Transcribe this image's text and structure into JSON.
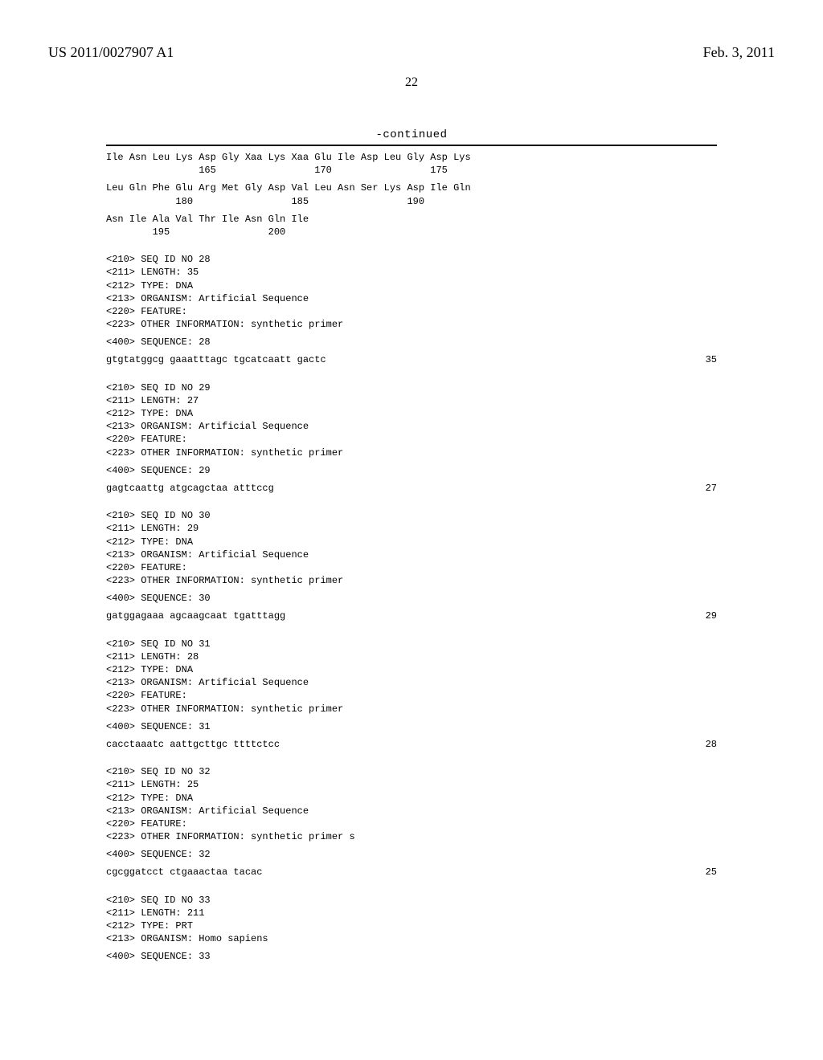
{
  "header": {
    "publication_id": "US 2011/0027907 A1",
    "publication_date": "Feb. 3, 2011",
    "page_number": "22"
  },
  "continued_label": "-continued",
  "protein_tail": {
    "row1_aa": "Ile Asn Leu Lys Asp Gly Xaa Lys Xaa Glu Ile Asp Leu Gly Asp Lys",
    "row1_pos": "                165                 170                 175",
    "row2_aa": "Leu Gln Phe Glu Arg Met Gly Asp Val Leu Asn Ser Lys Asp Ile Gln",
    "row2_pos": "            180                 185                 190",
    "row3_aa": "Asn Ile Ala Val Thr Ile Asn Gln Ile",
    "row3_pos": "        195                 200"
  },
  "entries": [
    {
      "seq_id": "<210> SEQ ID NO 28",
      "length": "<211> LENGTH: 35",
      "type": "<212> TYPE: DNA",
      "organism": "<213> ORGANISM: Artificial Sequence",
      "feature": "<220> FEATURE:",
      "other": "<223> OTHER INFORMATION: synthetic primer",
      "seq_label": "<400> SEQUENCE: 28",
      "seq_text": "gtgtatggcg gaaatttagc tgcatcaatt gactc",
      "seq_len": "35"
    },
    {
      "seq_id": "<210> SEQ ID NO 29",
      "length": "<211> LENGTH: 27",
      "type": "<212> TYPE: DNA",
      "organism": "<213> ORGANISM: Artificial Sequence",
      "feature": "<220> FEATURE:",
      "other": "<223> OTHER INFORMATION: synthetic primer",
      "seq_label": "<400> SEQUENCE: 29",
      "seq_text": "gagtcaattg atgcagctaa atttccg",
      "seq_len": "27"
    },
    {
      "seq_id": "<210> SEQ ID NO 30",
      "length": "<211> LENGTH: 29",
      "type": "<212> TYPE: DNA",
      "organism": "<213> ORGANISM: Artificial Sequence",
      "feature": "<220> FEATURE:",
      "other": "<223> OTHER INFORMATION: synthetic primer",
      "seq_label": "<400> SEQUENCE: 30",
      "seq_text": "gatggagaaa agcaagcaat tgatttagg",
      "seq_len": "29"
    },
    {
      "seq_id": "<210> SEQ ID NO 31",
      "length": "<211> LENGTH: 28",
      "type": "<212> TYPE: DNA",
      "organism": "<213> ORGANISM: Artificial Sequence",
      "feature": "<220> FEATURE:",
      "other": "<223> OTHER INFORMATION: synthetic primer",
      "seq_label": "<400> SEQUENCE: 31",
      "seq_text": "cacctaaatc aattgcttgc ttttctcc",
      "seq_len": "28"
    },
    {
      "seq_id": "<210> SEQ ID NO 32",
      "length": "<211> LENGTH: 25",
      "type": "<212> TYPE: DNA",
      "organism": "<213> ORGANISM: Artificial Sequence",
      "feature": "<220> FEATURE:",
      "other": "<223> OTHER INFORMATION: synthetic primer s",
      "seq_label": "<400> SEQUENCE: 32",
      "seq_text": "cgcggatcct ctgaaactaa tacac",
      "seq_len": "25"
    }
  ],
  "entry33": {
    "seq_id": "<210> SEQ ID NO 33",
    "length": "<211> LENGTH: 211",
    "type": "<212> TYPE: PRT",
    "organism": "<213> ORGANISM: Homo sapiens",
    "seq_label": "<400> SEQUENCE: 33"
  }
}
